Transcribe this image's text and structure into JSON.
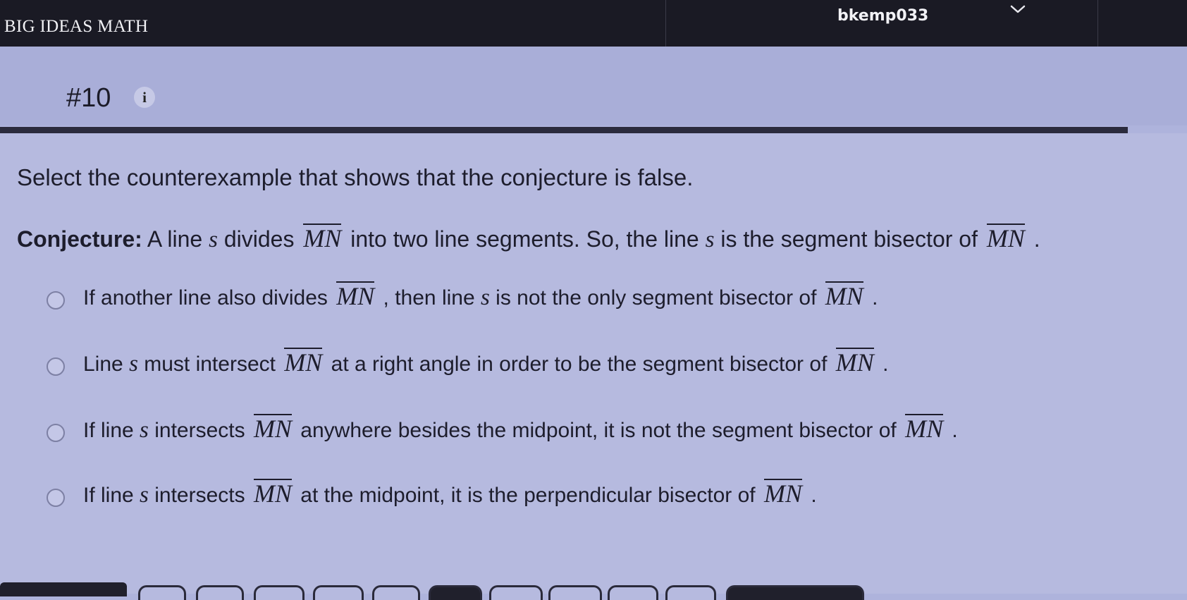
{
  "app": {
    "brand": "BIG IDEAS MATH",
    "username": "bkemp033"
  },
  "question": {
    "number": "#10",
    "info_glyph": "i"
  },
  "prompt": "Select the counterexample that shows that the conjecture is false.",
  "conjecture": {
    "label": "Conjecture:",
    "t1": " A line ",
    "v1": "s",
    "t2": " divides ",
    "seg1": "MN",
    "t3": " into two line segments.  So, the line ",
    "v2": "s",
    "t4": " is the segment bisector of ",
    "seg2": "MN",
    "t5": " ."
  },
  "options": [
    {
      "t1": "If another line also divides ",
      "seg1": "MN",
      "t2": " , then line ",
      "v1": "s",
      "t3": " is not the only segment bisector of ",
      "seg2": "MN",
      "t4": " ."
    },
    {
      "t1": "Line ",
      "v1": "s",
      "t2": " must intersect ",
      "seg1": "MN",
      "t3": " at a right angle in order to be the segment bisector of ",
      "seg2": "MN",
      "t4": " ."
    },
    {
      "t1": "If line ",
      "v1": "s",
      "t2": "  intersects ",
      "seg1": "MN",
      "t3": " anywhere besides the midpoint, it is not the segment bisector of ",
      "seg2": "MN",
      "t4": " ."
    },
    {
      "t1": "If line ",
      "v1": "s",
      "t2": " intersects ",
      "seg1": "MN",
      "t3": " at the midpoint, it is the perpendicular bisector of ",
      "seg2": "MN",
      "t4": " ."
    }
  ]
}
